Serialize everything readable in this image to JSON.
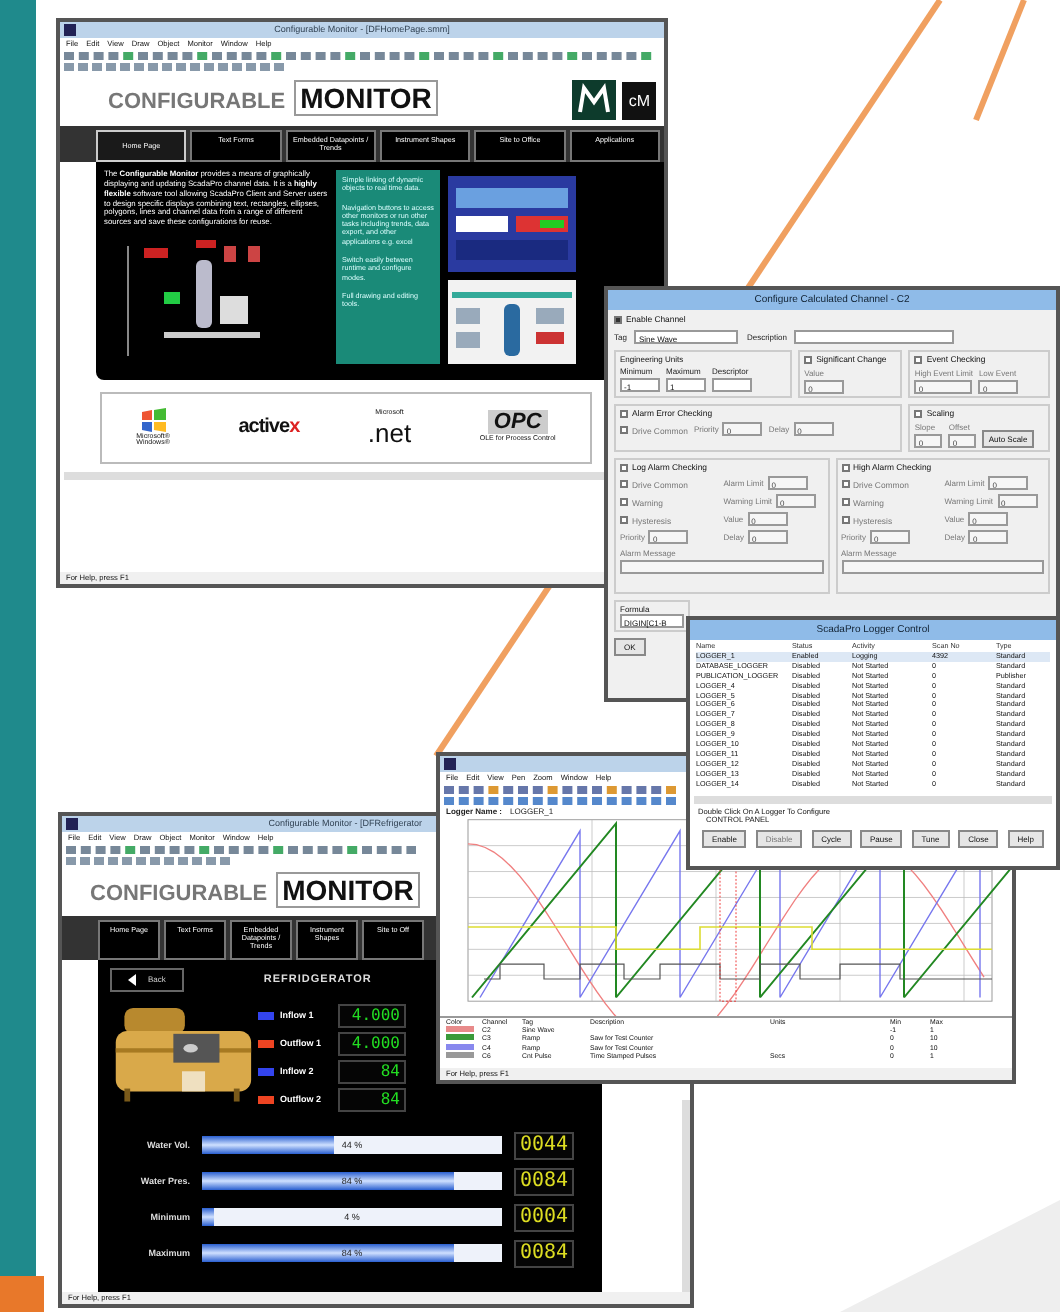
{
  "home_window": {
    "title": "Configurable Monitor - [DFHomePage.smm]",
    "menu": [
      "File",
      "Edit",
      "View",
      "Draw",
      "Object",
      "Monitor",
      "Window",
      "Help"
    ],
    "brand": {
      "light": "CONFIGURABLE",
      "bold": "MONITOR",
      "logo_text": "cM"
    },
    "nav_tabs": [
      {
        "label": "Home Page",
        "selected": true
      },
      {
        "label": "Text Forms",
        "selected": false
      },
      {
        "label": "Embedded Datapoints / Trends",
        "selected": false
      },
      {
        "label": "Instrument Shapes",
        "selected": false
      },
      {
        "label": "Site to Office",
        "selected": false
      },
      {
        "label": "Applications",
        "selected": false
      }
    ],
    "intro": "The **Configurable Monitor** provides a means of graphically displaying and updating ScadaPro channel data. It is a **highly flexible** software tool allowing ScadaPro Client and Server users to design specific displays combining text, rectangles, ellipses, polygons, lines and channel data from a range of different sources and save these configurations for reuse.",
    "features": [
      "Simple linking of dynamic objects to real time data.",
      "Navigation buttons to access other monitors or run other tasks including trends, data export, and other applications e.g. excel",
      "Switch easily between runtime and configure modes.",
      "Full drawing and editing tools."
    ],
    "logos": [
      {
        "kind": "windows",
        "lines": [
          "Microsoft®",
          "Windows®"
        ]
      },
      {
        "kind": "activex",
        "lines": [
          "active",
          "x"
        ]
      },
      {
        "kind": "net",
        "lines": [
          "Microsoft",
          ".net"
        ]
      },
      {
        "kind": "opc",
        "lines": [
          "OPC",
          "OLE for Process Control"
        ]
      }
    ],
    "status": "For Help, press F1"
  },
  "channel_dialog": {
    "title": "Configure Calculated Channel - C2",
    "enable": {
      "label": "Enable Channel",
      "checked": true
    },
    "tag": {
      "label": "Tag",
      "value": "Sine Wave"
    },
    "description": {
      "label": "Description"
    },
    "groups": [
      {
        "label": "Engineering Units",
        "kind": "frame",
        "items": [
          {
            "kind": "field",
            "label": "Minimum",
            "value": "-1"
          },
          {
            "kind": "field",
            "label": "Maximum",
            "value": "1"
          },
          {
            "kind": "field",
            "label": "Descriptor"
          }
        ]
      },
      {
        "label": "Significant Change",
        "kind": "check",
        "checked": false,
        "items": [
          {
            "kind": "field",
            "label": "Value",
            "value": "0"
          }
        ]
      },
      {
        "label": "Event Checking",
        "kind": "check",
        "checked": false,
        "items": [
          {
            "kind": "field",
            "label": "High Event Limit",
            "value": "0"
          },
          {
            "kind": "field",
            "label": "Low Event",
            "value": "0"
          }
        ]
      },
      {
        "label": "Alarm Error Checking",
        "kind": "check",
        "checked": false,
        "items": [
          {
            "kind": "check",
            "label": "Drive Common",
            "checked": false
          },
          {
            "kind": "inline",
            "label": "Priority",
            "value": "0"
          },
          {
            "kind": "inline",
            "label": "Delay",
            "value": "0"
          }
        ]
      },
      {
        "label": "Scaling",
        "kind": "check",
        "checked": false,
        "items": [
          {
            "kind": "field",
            "label": "Slope",
            "value": "0"
          },
          {
            "kind": "field",
            "label": "Offset",
            "value": "0"
          },
          {
            "kind": "button",
            "label": "Auto Scale"
          }
        ]
      },
      {
        "label": "Log Alarm Checking",
        "kind": "check",
        "checked": false,
        "items": [
          {
            "kind": "check",
            "label": "Drive Common",
            "checked": false
          },
          {
            "kind": "inline",
            "label": "Alarm Limit",
            "value": "0"
          },
          {
            "kind": "check",
            "label": "Warning",
            "checked": false
          },
          {
            "kind": "inline",
            "label": "Warning Limit",
            "value": "0"
          },
          {
            "kind": "check",
            "label": "Hysteresis",
            "checked": false
          },
          {
            "kind": "inline",
            "label": "Value",
            "value": "0"
          },
          {
            "kind": "inline",
            "label": "Priority",
            "value": "0"
          },
          {
            "kind": "inline",
            "label": "Delay",
            "value": "0"
          },
          {
            "kind": "wide",
            "label": "Alarm Message"
          }
        ]
      },
      {
        "label": "High Alarm Checking",
        "kind": "check",
        "checked": false,
        "items": [
          {
            "kind": "check",
            "label": "Drive Common",
            "checked": false
          },
          {
            "kind": "inline",
            "label": "Alarm Limit",
            "value": "0"
          },
          {
            "kind": "check",
            "label": "Warning",
            "checked": false
          },
          {
            "kind": "inline",
            "label": "Warning Limit",
            "value": "0"
          },
          {
            "kind": "check",
            "label": "Hysteresis",
            "checked": false
          },
          {
            "kind": "inline",
            "label": "Value",
            "value": "0"
          },
          {
            "kind": "inline",
            "label": "Priority",
            "value": "0"
          },
          {
            "kind": "inline",
            "label": "Delay",
            "value": "0"
          },
          {
            "kind": "wide",
            "label": "Alarm Message"
          }
        ]
      }
    ],
    "formula": {
      "label": "Formula",
      "value": "DIGIN[C1-B"
    },
    "buttons": [
      "OK"
    ]
  },
  "logger_window": {
    "title": "ScadaPro Logger Control",
    "columns": [
      "Name",
      "Status",
      "Activity",
      "Scan No",
      "Type"
    ],
    "rows": [
      {
        "cells": [
          "LOGGER_1",
          "Enabled",
          "Logging",
          "4392",
          "Standard"
        ],
        "selected": true
      },
      {
        "cells": [
          "DATABASE_LOGGER",
          "Disabled",
          "Not Started",
          "0",
          "Standard"
        ],
        "selected": false
      },
      {
        "cells": [
          "PUBLICATION_LOGGER",
          "Disabled",
          "Not Started",
          "0",
          "Publisher"
        ],
        "selected": false
      },
      {
        "cells": [
          "LOGGER_4",
          "Disabled",
          "Not Started",
          "0",
          "Standard"
        ],
        "selected": false
      },
      {
        "cells": [
          "LOGGER_5",
          "Disabled",
          "Not Started",
          "0",
          "Standard"
        ],
        "selected": false
      },
      {
        "cells": [
          "LOGGER_6",
          "Disabled",
          "Not Started",
          "0",
          "Standard"
        ],
        "selected": false
      },
      {
        "cells": [
          "LOGGER_7",
          "Disabled",
          "Not Started",
          "0",
          "Standard"
        ],
        "selected": false
      },
      {
        "cells": [
          "LOGGER_8",
          "Disabled",
          "Not Started",
          "0",
          "Standard"
        ],
        "selected": false
      },
      {
        "cells": [
          "LOGGER_9",
          "Disabled",
          "Not Started",
          "0",
          "Standard"
        ],
        "selected": false
      },
      {
        "cells": [
          "LOGGER_10",
          "Disabled",
          "Not Started",
          "0",
          "Standard"
        ],
        "selected": false
      },
      {
        "cells": [
          "LOGGER_11",
          "Disabled",
          "Not Started",
          "0",
          "Standard"
        ],
        "selected": false
      },
      {
        "cells": [
          "LOGGER_12",
          "Disabled",
          "Not Started",
          "0",
          "Standard"
        ],
        "selected": false
      },
      {
        "cells": [
          "LOGGER_13",
          "Disabled",
          "Not Started",
          "0",
          "Standard"
        ],
        "selected": false
      },
      {
        "cells": [
          "LOGGER_14",
          "Disabled",
          "Not Started",
          "0",
          "Standard"
        ],
        "selected": false
      }
    ],
    "hint": "Double Click On A Logger To Configure",
    "panel_label": "CONTROL PANEL",
    "buttons": [
      {
        "label": "Enable",
        "disabled": false
      },
      {
        "label": "Disable",
        "disabled": true
      },
      {
        "label": "Cycle",
        "disabled": false
      },
      {
        "label": "Pause",
        "disabled": false
      },
      {
        "label": "Tune",
        "disabled": false
      },
      {
        "label": "Close",
        "disabled": false
      },
      {
        "label": "Help",
        "disabled": false
      }
    ]
  },
  "trend_window": {
    "menu": [
      "File",
      "Edit",
      "View",
      "Pen",
      "Zoom",
      "Window",
      "Help"
    ],
    "logger_label": "Logger Name :",
    "logger_value": "LOGGER_1",
    "legend_columns": [
      "Color",
      "Channel",
      "Tag",
      "Description",
      "Units",
      "Min",
      "Max"
    ],
    "legend_rows": [
      {
        "color": "#e88a8a",
        "cells": [
          "C2",
          "Sine Wave",
          "",
          "",
          "-1",
          "1"
        ]
      },
      {
        "color": "#3a9a3a",
        "cells": [
          "C3",
          "Ramp",
          "Saw for Test Counter",
          "",
          "0",
          "10"
        ]
      },
      {
        "color": "#8888ee",
        "cells": [
          "C4",
          "Ramp",
          "Saw for Test Counter",
          "",
          "0",
          "10"
        ]
      },
      {
        "color": "#999999",
        "cells": [
          "C6",
          "Cnt Pulse",
          "Time Stamped Pulses",
          "Secs",
          "0",
          "1"
        ]
      }
    ],
    "status": "For Help, press F1"
  },
  "fridge_window": {
    "title": "Configurable Monitor - [DFRefrigerator",
    "menu": [
      "File",
      "Edit",
      "View",
      "Draw",
      "Object",
      "Monitor",
      "Window",
      "Help"
    ],
    "brand": {
      "light": "CONFIGURABLE",
      "bold": "MONITOR"
    },
    "nav_tabs": [
      {
        "label": "Home Page",
        "selected": false
      },
      {
        "label": "Text Forms",
        "selected": false
      },
      {
        "label": "Embedded Datapoints / Trends",
        "selected": false
      },
      {
        "label": "Instrument Shapes",
        "selected": false
      },
      {
        "label": "Site to Off",
        "selected": false
      }
    ],
    "back": "Back",
    "heading": "REFRIDGERATOR",
    "flows": [
      {
        "label": "Inflow 1",
        "value": "4.000",
        "color": "#3344ee"
      },
      {
        "label": "Outflow 1",
        "value": "4.000",
        "color": "#ee4422"
      },
      {
        "label": "Inflow 2",
        "value": "84",
        "color": "#3344ee"
      },
      {
        "label": "Outflow 2",
        "value": "84",
        "color": "#ee4422"
      }
    ],
    "gauges": [
      {
        "label": "Water Vol.",
        "level": 0.44,
        "reading": "44 %",
        "display": "0044"
      },
      {
        "label": "Water Pres.",
        "level": 0.84,
        "reading": "84 %",
        "display": "0084"
      },
      {
        "label": "Minimum",
        "level": 0.04,
        "reading": "4 %",
        "display": "0004"
      },
      {
        "label": "Maximum",
        "level": 0.84,
        "reading": "84 %",
        "display": "0084"
      }
    ],
    "status": "For Help, press F1"
  }
}
